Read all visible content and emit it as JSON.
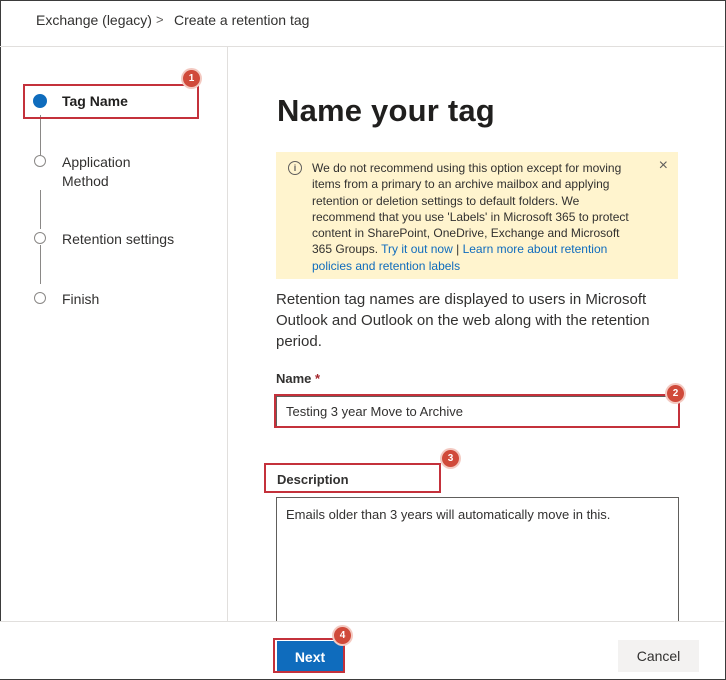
{
  "breadcrumb": {
    "parent": "Exchange (legacy)",
    "separator": ">",
    "current": "Create a retention tag"
  },
  "wizard": {
    "steps": [
      {
        "label": "Tag Name",
        "state": "active"
      },
      {
        "label": "Application Method",
        "state": "pending"
      },
      {
        "label": "Retention settings",
        "state": "pending"
      },
      {
        "label": "Finish",
        "state": "pending"
      }
    ]
  },
  "main": {
    "title": "Name your tag",
    "warning": {
      "icon": "info-icon",
      "text": "We do not recommend using this option except for moving items from a primary to an archive mailbox and applying retention or deletion settings to default folders. We recommend that you use 'Labels' in Microsoft 365 to protect content in SharePoint, OneDrive, Exchange and Microsoft 365 Groups.",
      "link1": "Try it out now",
      "link_sep": "|",
      "link2": "Learn more about retention policies and retention labels",
      "close_icon": "×"
    },
    "intro": "Retention tag names are displayed to users in Microsoft Outlook and Outlook on the web along with the retention period.",
    "name_label": "Name",
    "required_mark": "*",
    "name_value": "Testing 3 year Move to Archive",
    "description_label": "Description",
    "description_value": "Emails older than 3 years will automatically move in this."
  },
  "footer": {
    "next_label": "Next",
    "cancel_label": "Cancel"
  },
  "annotations": [
    "1",
    "2",
    "3",
    "4"
  ],
  "colors": {
    "accent": "#0f6cbd",
    "highlight": "#c4313b",
    "badge": "#d04a3a",
    "warning_bg": "#fff4ce"
  }
}
